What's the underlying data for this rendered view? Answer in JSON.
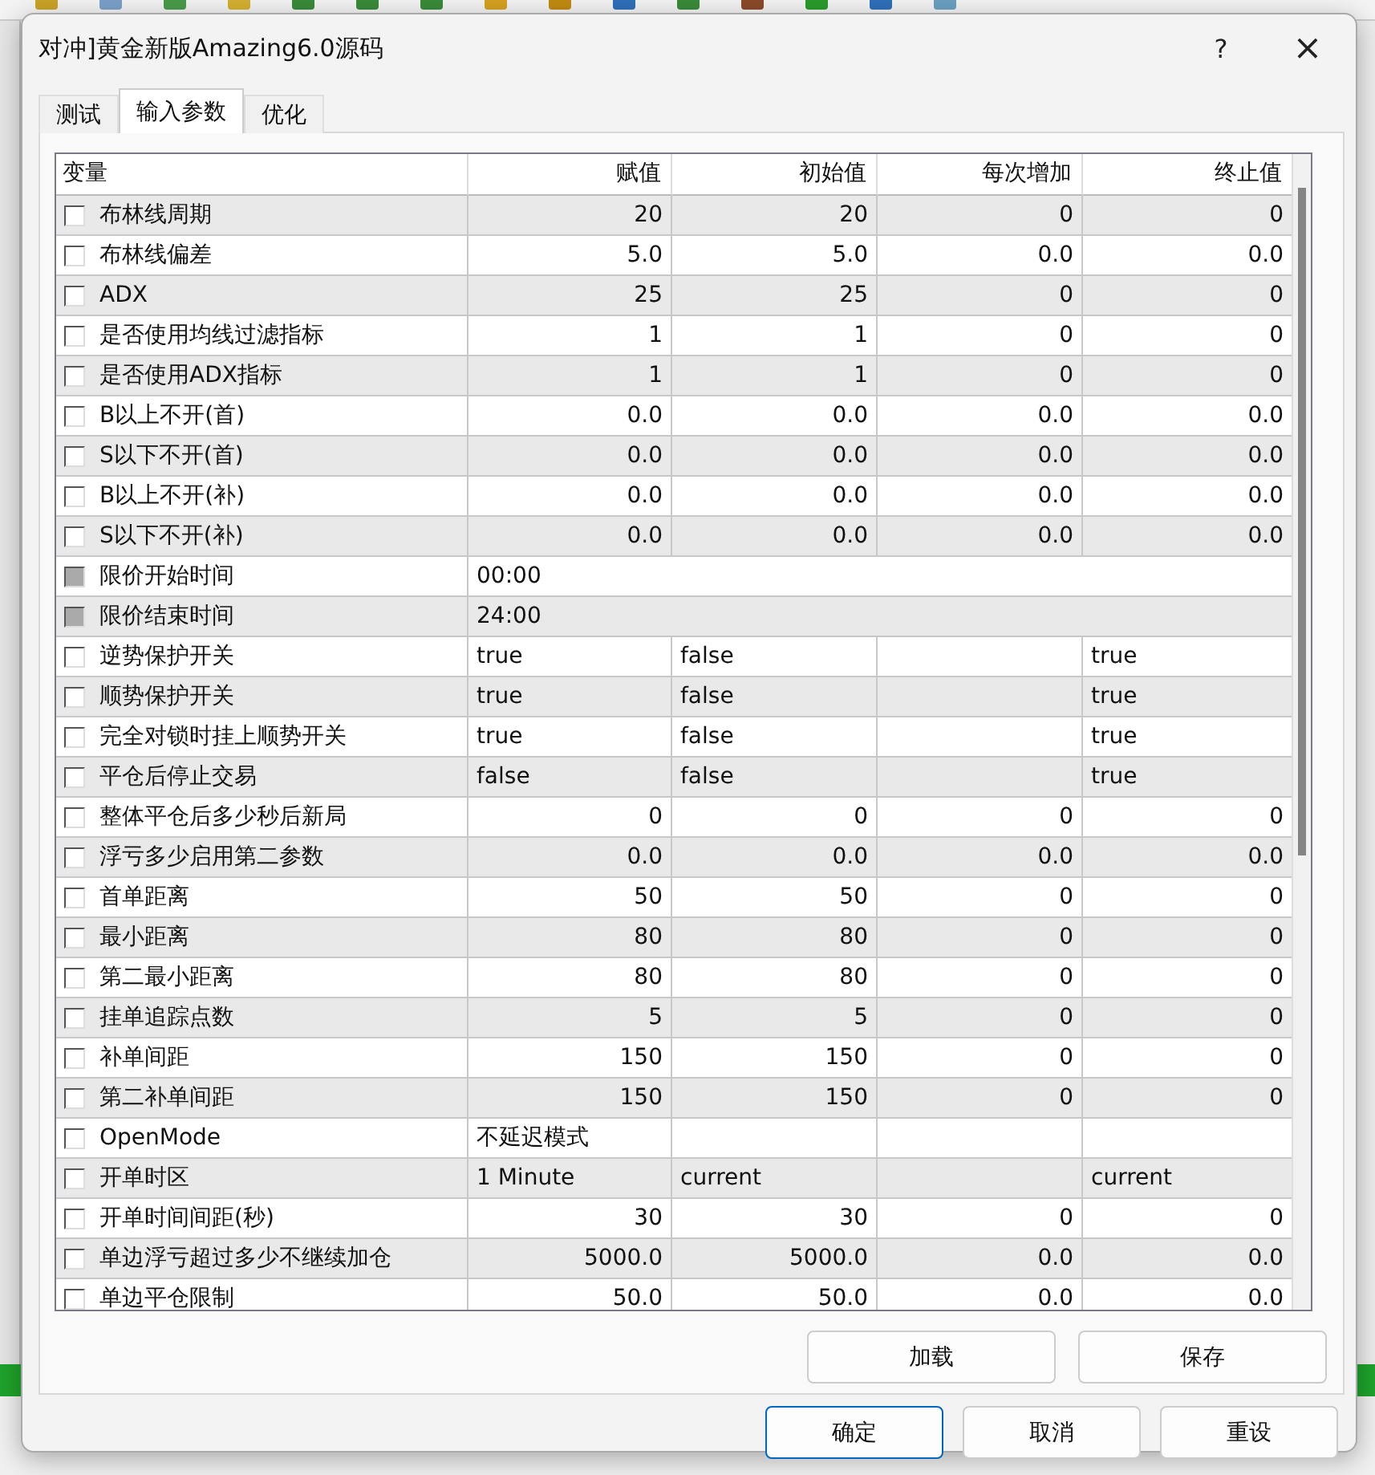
{
  "window": {
    "title": "对冲]黄金新版Amazing6.0源码",
    "help": "?",
    "close": "×"
  },
  "tabs": [
    {
      "label": "测试",
      "selected": false
    },
    {
      "label": "输入参数",
      "selected": true
    },
    {
      "label": "优化",
      "selected": false
    }
  ],
  "table": {
    "columns": [
      "变量",
      "赋值",
      "初始值",
      "每次增加",
      "终止值"
    ],
    "rows": [
      {
        "kind": "number",
        "name": "布林线周期",
        "checked": false,
        "disabled": false,
        "value": "20",
        "start": "20",
        "step": "0",
        "stop": "0"
      },
      {
        "kind": "number",
        "name": "布林线偏差",
        "checked": false,
        "disabled": false,
        "value": "5.0",
        "start": "5.0",
        "step": "0.0",
        "stop": "0.0"
      },
      {
        "kind": "number",
        "name": "ADX",
        "checked": false,
        "disabled": false,
        "value": "25",
        "start": "25",
        "step": "0",
        "stop": "0"
      },
      {
        "kind": "number",
        "name": "是否使用均线过滤指标",
        "checked": false,
        "disabled": false,
        "value": "1",
        "start": "1",
        "step": "0",
        "stop": "0"
      },
      {
        "kind": "number",
        "name": "是否使用ADX指标",
        "checked": false,
        "disabled": false,
        "value": "1",
        "start": "1",
        "step": "0",
        "stop": "0"
      },
      {
        "kind": "number",
        "name": "B以上不开(首)",
        "checked": false,
        "disabled": false,
        "value": "0.0",
        "start": "0.0",
        "step": "0.0",
        "stop": "0.0"
      },
      {
        "kind": "number",
        "name": "S以下不开(首)",
        "checked": false,
        "disabled": false,
        "value": "0.0",
        "start": "0.0",
        "step": "0.0",
        "stop": "0.0"
      },
      {
        "kind": "number",
        "name": "B以上不开(补)",
        "checked": false,
        "disabled": false,
        "value": "0.0",
        "start": "0.0",
        "step": "0.0",
        "stop": "0.0"
      },
      {
        "kind": "number",
        "name": "S以下不开(补)",
        "checked": false,
        "disabled": false,
        "value": "0.0",
        "start": "0.0",
        "step": "0.0",
        "stop": "0.0"
      },
      {
        "kind": "time",
        "name": "限价开始时间",
        "checked": false,
        "disabled": true,
        "value": "00:00"
      },
      {
        "kind": "time",
        "name": "限价结束时间",
        "checked": false,
        "disabled": true,
        "value": "24:00"
      },
      {
        "kind": "text",
        "name": "逆势保护开关",
        "checked": false,
        "disabled": false,
        "value": "true",
        "start": "false",
        "stop": "true"
      },
      {
        "kind": "text",
        "name": "顺势保护开关",
        "checked": false,
        "disabled": false,
        "value": "true",
        "start": "false",
        "stop": "true"
      },
      {
        "kind": "text",
        "name": "完全对锁时挂上顺势开关",
        "checked": false,
        "disabled": false,
        "value": "true",
        "start": "false",
        "stop": "true"
      },
      {
        "kind": "text",
        "name": "平仓后停止交易",
        "checked": false,
        "disabled": false,
        "value": "false",
        "start": "false",
        "stop": "true"
      },
      {
        "kind": "number",
        "name": "整体平仓后多少秒后新局",
        "checked": false,
        "disabled": false,
        "value": "0",
        "start": "0",
        "step": "0",
        "stop": "0"
      },
      {
        "kind": "number",
        "name": "浮亏多少启用第二参数",
        "checked": false,
        "disabled": false,
        "value": "0.0",
        "start": "0.0",
        "step": "0.0",
        "stop": "0.0"
      },
      {
        "kind": "number",
        "name": "首单距离",
        "checked": false,
        "disabled": false,
        "value": "50",
        "start": "50",
        "step": "0",
        "stop": "0"
      },
      {
        "kind": "number",
        "name": "最小距离",
        "checked": false,
        "disabled": false,
        "value": "80",
        "start": "80",
        "step": "0",
        "stop": "0"
      },
      {
        "kind": "number",
        "name": "第二最小距离",
        "checked": false,
        "disabled": false,
        "value": "80",
        "start": "80",
        "step": "0",
        "stop": "0"
      },
      {
        "kind": "number",
        "name": "挂单追踪点数",
        "checked": false,
        "disabled": false,
        "value": "5",
        "start": "5",
        "step": "0",
        "stop": "0"
      },
      {
        "kind": "number",
        "name": "补单间距",
        "checked": false,
        "disabled": false,
        "value": "150",
        "start": "150",
        "step": "0",
        "stop": "0"
      },
      {
        "kind": "number",
        "name": "第二补单间距",
        "checked": false,
        "disabled": false,
        "value": "150",
        "start": "150",
        "step": "0",
        "stop": "0"
      },
      {
        "kind": "text",
        "name": "OpenMode",
        "checked": false,
        "disabled": false,
        "value": "不延迟模式"
      },
      {
        "kind": "text",
        "name": "开单时区",
        "checked": false,
        "disabled": false,
        "value": "1 Minute",
        "start": "current",
        "stop": "current"
      },
      {
        "kind": "number",
        "name": "开单时间间距(秒)",
        "checked": false,
        "disabled": false,
        "value": "30",
        "start": "30",
        "step": "0",
        "stop": "0"
      },
      {
        "kind": "number",
        "name": "单边浮亏超过多少不继续加仓",
        "checked": false,
        "disabled": false,
        "value": "5000.0",
        "start": "5000.0",
        "step": "0.0",
        "stop": "0.0"
      },
      {
        "kind": "number",
        "name": "单边平仓限制",
        "checked": false,
        "disabled": false,
        "value": "50.0",
        "start": "50.0",
        "step": "0.0",
        "stop": "0.0"
      }
    ]
  },
  "panel_buttons": [
    {
      "label": "加载",
      "default": false
    },
    {
      "label": "保存",
      "default": false
    }
  ],
  "dialog_buttons": [
    {
      "label": "确定",
      "default": true
    },
    {
      "label": "取消",
      "default": false
    },
    {
      "label": "重设",
      "default": false
    }
  ]
}
